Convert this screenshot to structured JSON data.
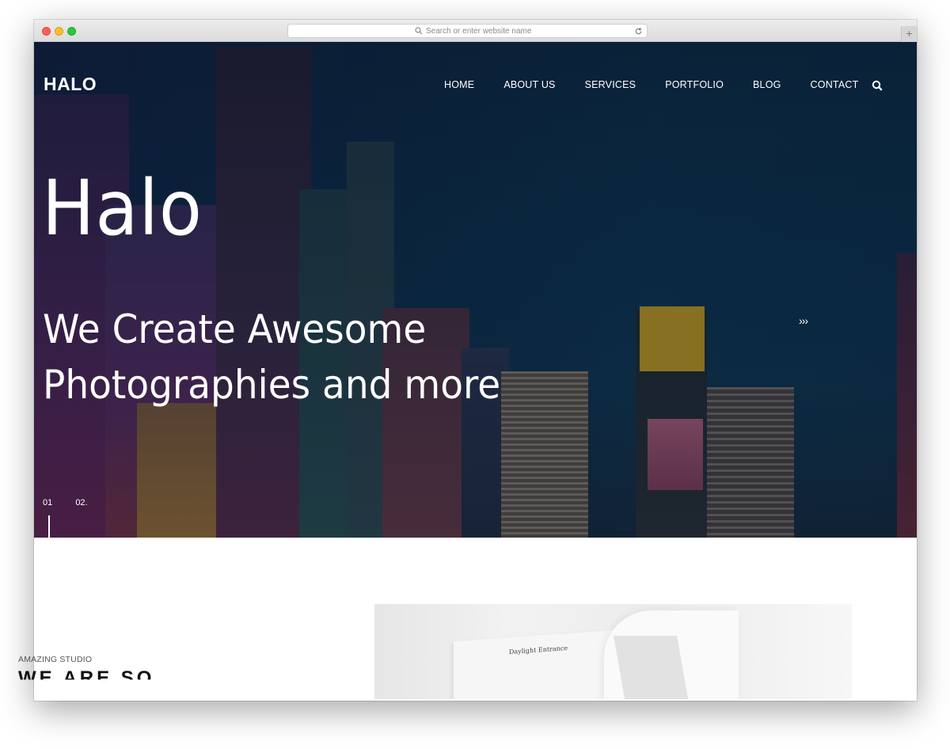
{
  "browser": {
    "url_placeholder": "Search or enter website name",
    "new_tab_label": "+"
  },
  "site": {
    "logo": "HALO",
    "nav": [
      "HOME",
      "ABOUT US",
      "SERVICES",
      "PORTFOLIO",
      "BLOG",
      "CONTACT"
    ]
  },
  "hero": {
    "title": "Halo",
    "subtitle_line1": "We Create Awesome",
    "subtitle_line2": "Photographies and more",
    "next_arrow": "›››",
    "slides": [
      "01",
      "02."
    ]
  },
  "about": {
    "kicker": "AMAZING STUDIO",
    "heading": "WE ARE SO",
    "image_book_title": "Daylight Entrance"
  }
}
